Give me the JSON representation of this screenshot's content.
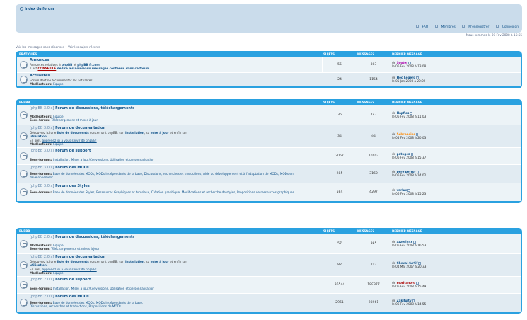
{
  "nav": {
    "crumb": "Index du forum",
    "links": [
      "FAQ",
      "Membres",
      "M'enregistrer",
      "Connexion"
    ]
  },
  "datetime": "Nous sommes le 06 Fév 2008 à 15:55",
  "viewlinks": "Voir les messages sans réponses • Voir les sujets récents",
  "columns": {
    "topics": "Sujets",
    "posts": "Messages",
    "last": "Dernier message"
  },
  "cat1": {
    "title": "Pratiques",
    "rows": [
      {
        "title": "Annonces",
        "desc_a": "Annonces relatives à ",
        "desc_b": "phpBB",
        "desc_c": " et ",
        "desc_d": "phpBB fr.com",
        "desc_e": "Il est ",
        "desc_f": "CONSEILLÉ",
        "desc_g": " de lire les nouveaux messages contenus dans ce forum",
        "topics": "55",
        "posts": "303",
        "last_user": "Sooter",
        "last_date": "le 06 Fév 2008 à 13:08"
      },
      {
        "title": "Actualités",
        "desc": "Forum destiné à commenter les actualités.",
        "mod_label": "Modérateurs:",
        "mod": "Equipe",
        "topics": "24",
        "posts": "1154",
        "last_user": "Hec Legerg",
        "last_date": "le 05 Jan 2008 à 20:02"
      }
    ]
  },
  "cat2": {
    "title": "phpBB",
    "rows": [
      {
        "tag": "[phpBB 3.0.x]",
        "title": " Forum de discussions, téléchargements",
        "mod_label": "Modérateurs:",
        "mod": "Equipe",
        "sub_label": "Sous-forum:",
        "sub": "Téléchargement et mises à jour",
        "topics": "36",
        "posts": "757",
        "last_user": "Hapfios",
        "last_date": "le 06 Fév 2008 à 11:03"
      },
      {
        "tag": "[phpBB 3.0.x]",
        "title": " Forum de documentation",
        "desc_a": "Découvrez ici une ",
        "desc_b": "liste de documents",
        "desc_c": " concernant phpBB: son ",
        "desc_d": "installation",
        "desc_e": ", sa ",
        "desc_f": "mise à jour",
        "desc_g": " et enfin son ",
        "desc_h": "utilisation.",
        "desc_i": "En bref, ",
        "desc_j": "apprenez ici à vous servir de phpBB!",
        "mod_label": "Modérateurs:",
        "mod": "Equipe",
        "topics": "34",
        "posts": "44",
        "last_user": "Sebceasins",
        "last_date": "le 05 Fév 2008 à 20:03"
      },
      {
        "tag": "[phpBB 3.0.x]",
        "title": " Forum de support",
        "sub_label": "Sous-forums:",
        "sub": "Installation, Mises à jour/Conversions, Utilisation et personnalisation",
        "topics": "2057",
        "posts": "10202",
        "last_user": "patogez",
        "last_date": "le 06 Fév 2008 à 15:37"
      },
      {
        "tag": "[phpBB 3.0.x]",
        "title": " Forum des MODs",
        "sub_label": "Sous-forums:",
        "sub": "Base de données des MODs, MODs indépendants de la base, Discussions, recherches et traductions, Aide au développement et à l'adaptation de MODs, MODs en développement",
        "topics": "285",
        "posts": "3160",
        "last_user": "pere perror",
        "last_date": "le 06 Fév 2008 à 14:02"
      },
      {
        "tag": "[phpBB 3.0.x]",
        "title": " Forum des Styles",
        "sub_label": "Sous-forums:",
        "sub": "Base de données des Styles, Ressources Graphiques et tutoriaux, Création graphique, Modifications et recherche de styles, Propositions de ressources graphiques",
        "topics": "584",
        "posts": "4297",
        "last_user": "varlue",
        "last_date": "le 06 Fév 2008 à 15:23"
      }
    ]
  },
  "cat3": {
    "title": "phpBB",
    "rows": [
      {
        "tag": "[phpBB 2.0.x]",
        "title": " Forum de discussions, téléchargements",
        "mod_label": "Modérateurs:",
        "mod": "Equipe",
        "sub_label": "Sous-forum:",
        "sub": "Téléchargements et mises à jour",
        "topics": "57",
        "posts": "395",
        "last_user": "azzerlynx",
        "last_date": "le 06 Fév 2008 à 16:53"
      },
      {
        "tag": "[phpBB 2.0.x]",
        "title": " Forum de documentation",
        "desc_a": "Découvrez ici une ",
        "desc_b": "liste de documents",
        "desc_c": " concernant phpBB: son ",
        "desc_d": "installation",
        "desc_e": ", sa ",
        "desc_f": "mise à jour",
        "desc_g": " et enfin son ",
        "desc_h": "utilisation.",
        "desc_i": "En bref, ",
        "desc_j": "apprenez ici à vous servir de phpBB!",
        "mod_label": "Modérateurs:",
        "mod": "Equipe",
        "topics": "82",
        "posts": "212",
        "last_user": "Cheval-furtif",
        "last_date": "le 04 Mai 2007 à 20:33"
      },
      {
        "tag": "[phpBB 2.0.x]",
        "title": " Forum de support",
        "sub_label": "Sous-forums:",
        "sub": "Installation, Mises à jour/Conversions, Utilisation et personnalisation",
        "topics": "36544",
        "posts": "189377",
        "last_user": "moritanord",
        "last_date": "le 06 Fév 2008 à 15:49"
      },
      {
        "tag": "[phpBB 2.0.x]",
        "title": " Forum des MODs",
        "sub_label": "Sous-forums:",
        "sub": "Base de données des MODs, MODs indépendants de la base,",
        "sub2": "Discussions, recherches et traductions, Propositions de MODs",
        "topics": "2961",
        "posts": "20261",
        "last_user": "Zakifuitv",
        "last_date": "le 06 Fév 2008 à 14:55"
      }
    ]
  }
}
